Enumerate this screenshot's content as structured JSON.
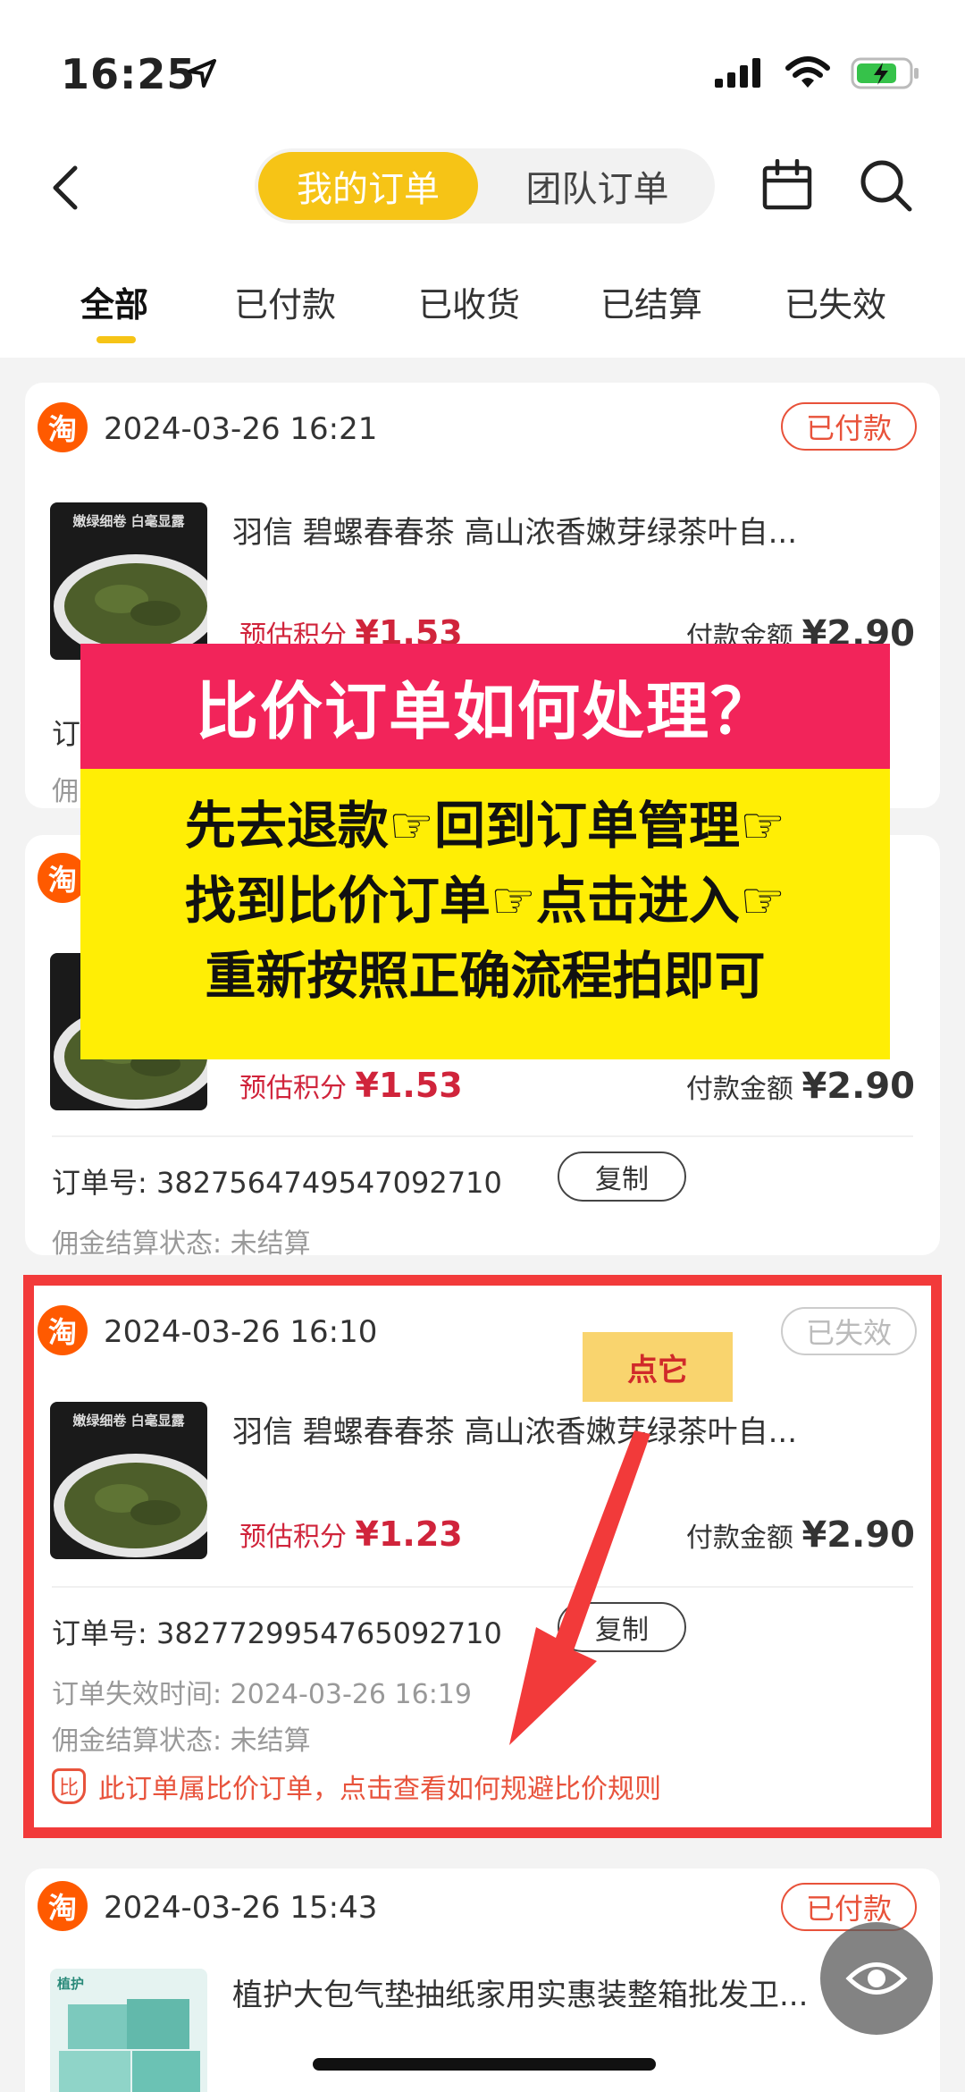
{
  "status_bar": {
    "time": "16:25"
  },
  "nav": {
    "tab_mine": "我的订单",
    "tab_team": "团队订单"
  },
  "filter_tabs": [
    "全部",
    "已付款",
    "已收货",
    "已结算",
    "已失效"
  ],
  "overlay": {
    "title": "比价订单如何处理？",
    "line1": "先去退款☞回到订单管理☞",
    "line2": "找到比价订单☞点击进入☞",
    "line3": "重新按照正确流程拍即可",
    "tap_label": "点它"
  },
  "orders": [
    {
      "platform": "淘",
      "datetime": "2024-03-26 16:21",
      "status": "已付款",
      "title": "羽信 碧螺春春茶 高山浓香嫩芽绿茶叶自...",
      "points_label": "预估积分",
      "points": "¥1.53",
      "paid_label": "付款金额",
      "paid": "¥2.90",
      "order_no_label": "订",
      "commission_label": "佣"
    },
    {
      "platform": "淘",
      "points_label": "预估积分",
      "points": "¥1.53",
      "paid_label": "付款金额",
      "paid": "¥2.90",
      "order_no_label": "订单号:",
      "order_no": "3827564749547092710",
      "copy_label": "复制",
      "commission_status": "佣金结算状态: 未结算"
    },
    {
      "platform": "淘",
      "datetime": "2024-03-26 16:10",
      "status": "已失效",
      "title": "羽信 碧螺春春茶 高山浓香嫩芽绿茶叶自...",
      "points_label": "预估积分",
      "points": "¥1.23",
      "paid_label": "付款金额",
      "paid": "¥2.90",
      "order_no_label": "订单号:",
      "order_no": "3827729954765092710",
      "copy_label": "复制",
      "invalid_time": "订单失效时间: 2024-03-26 16:19",
      "commission_status": "佣金结算状态: 未结算",
      "warning": "此订单属比价订单，点击查看如何规避比价规则",
      "warning_icon_text": "比"
    },
    {
      "platform": "淘",
      "datetime": "2024-03-26 15:43",
      "status": "已付款",
      "title": "植护大包气垫抽纸家用实惠装整箱批发卫...",
      "product_brand": "植护"
    }
  ],
  "product_image_text": "嫩绿细卷 白毫显露",
  "colors": {
    "accent": "#f6c416",
    "price": "#d0243b",
    "status": "#e8523a"
  }
}
